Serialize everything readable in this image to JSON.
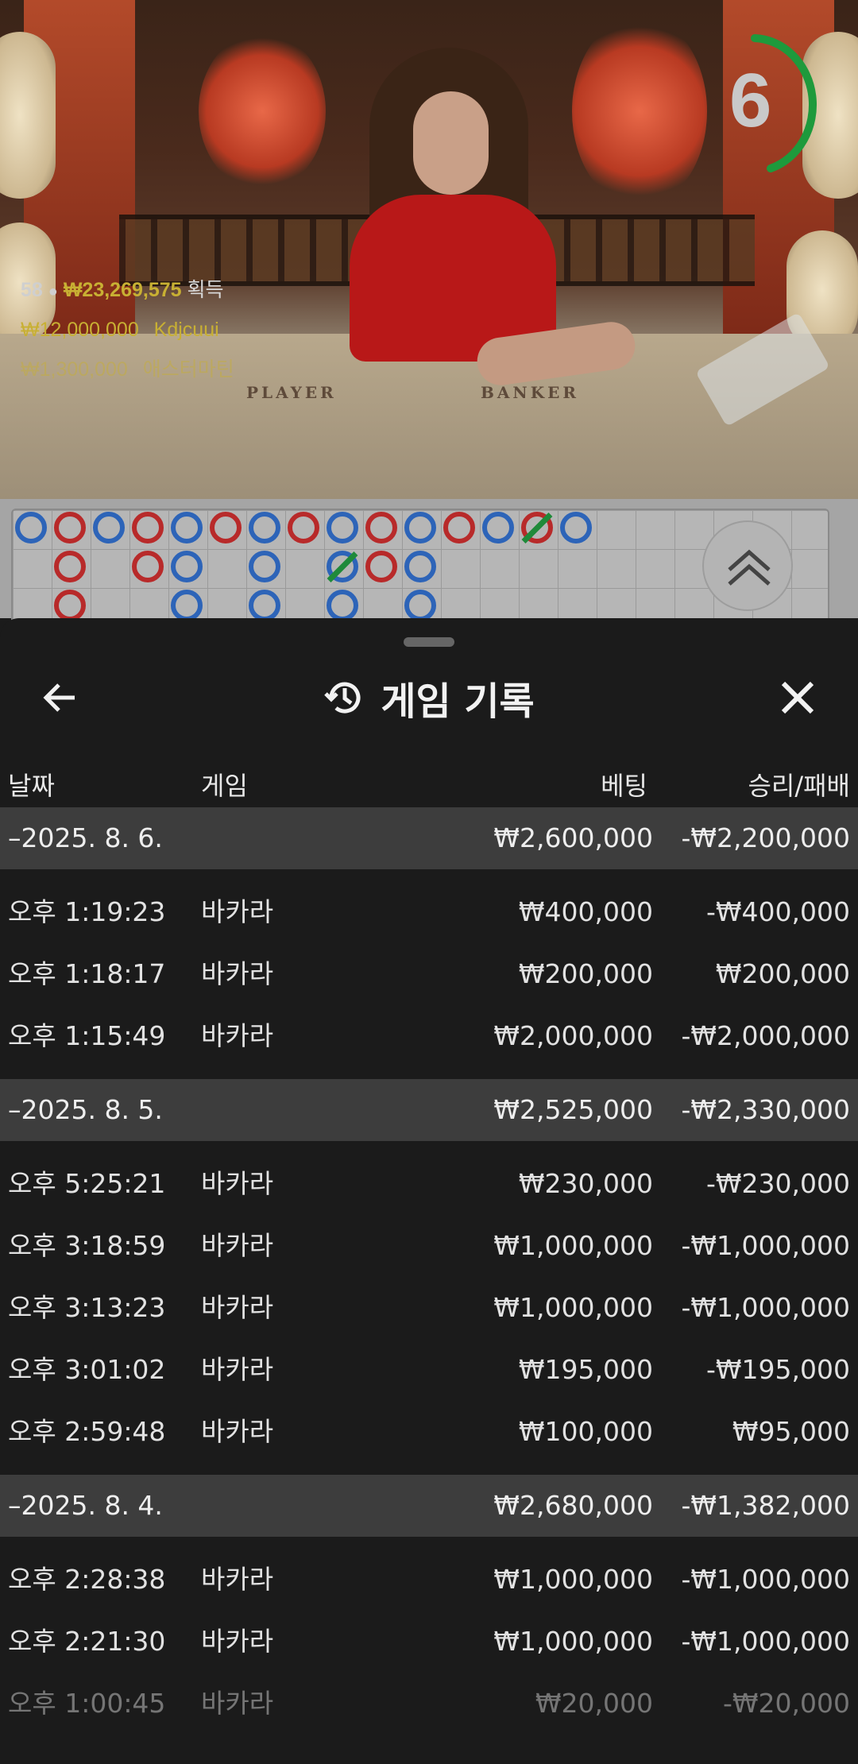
{
  "video": {
    "timer_value": "6",
    "table_labels": [
      "PLAYER",
      "BANKER"
    ],
    "winners": [
      {
        "count": "58",
        "amount": "₩23,269,575",
        "label": "획득"
      },
      {
        "amount": "₩12,000,000",
        "name": "Kdjcuui"
      },
      {
        "amount": "₩1,300,000",
        "name": "애스터마틴"
      }
    ]
  },
  "roadmap": {
    "colors": {
      "banker": "#b82a2a",
      "player": "#2d64b8",
      "tie": "#1f8a3a"
    }
  },
  "sheet": {
    "title": "게임 기록",
    "icons": {
      "back": "arrow-left-icon",
      "history": "history-icon",
      "close": "close-icon"
    },
    "columns": {
      "date": "날짜",
      "game": "게임",
      "bet": "베팅",
      "result": "승리/패배"
    },
    "groups": [
      {
        "date": "–2025. 8. 6.",
        "bet": "₩2,600,000",
        "result": "-₩2,200,000",
        "rows": [
          {
            "time": "오후 1:19:23",
            "game": "바카라",
            "bet": "₩400,000",
            "result": "-₩400,000"
          },
          {
            "time": "오후 1:18:17",
            "game": "바카라",
            "bet": "₩200,000",
            "result": "₩200,000"
          },
          {
            "time": "오후 1:15:49",
            "game": "바카라",
            "bet": "₩2,000,000",
            "result": "-₩2,000,000"
          }
        ]
      },
      {
        "date": "–2025. 8. 5.",
        "bet": "₩2,525,000",
        "result": "-₩2,330,000",
        "rows": [
          {
            "time": "오후 5:25:21",
            "game": "바카라",
            "bet": "₩230,000",
            "result": "-₩230,000"
          },
          {
            "time": "오후 3:18:59",
            "game": "바카라",
            "bet": "₩1,000,000",
            "result": "-₩1,000,000"
          },
          {
            "time": "오후 3:13:23",
            "game": "바카라",
            "bet": "₩1,000,000",
            "result": "-₩1,000,000"
          },
          {
            "time": "오후 3:01:02",
            "game": "바카라",
            "bet": "₩195,000",
            "result": "-₩195,000"
          },
          {
            "time": "오후 2:59:48",
            "game": "바카라",
            "bet": "₩100,000",
            "result": "₩95,000"
          }
        ]
      },
      {
        "date": "–2025. 8. 4.",
        "bet": "₩2,680,000",
        "result": "-₩1,382,000",
        "rows": [
          {
            "time": "오후 2:28:38",
            "game": "바카라",
            "bet": "₩1,000,000",
            "result": "-₩1,000,000"
          },
          {
            "time": "오후 2:21:30",
            "game": "바카라",
            "bet": "₩1,000,000",
            "result": "-₩1,000,000"
          },
          {
            "time": "오후 1:00:45",
            "game": "바카라",
            "bet": "₩20,000",
            "result": "-₩20,000"
          }
        ]
      }
    ]
  }
}
